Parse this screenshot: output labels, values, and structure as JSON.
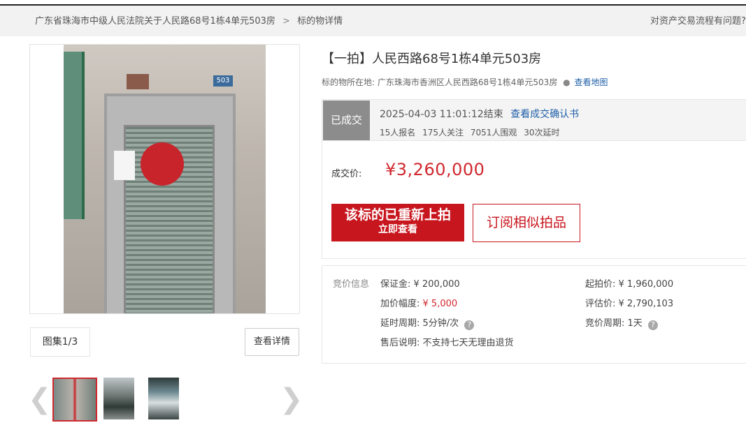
{
  "breadcrumb": {
    "parent": "广东省珠海市中级人民法院关于人民路68号1栋4单元503房",
    "separator": ">",
    "current": "标的物详情"
  },
  "help_text": "对资产交易流程有问题?",
  "gallery": {
    "album_label": "图集1/3",
    "detail_button": "查看详情",
    "plate_text": "503",
    "prev_icon": "chevron-left-icon",
    "next_icon": "chevron-right-icon",
    "thumb_count": 3
  },
  "item": {
    "title": "【一拍】人民西路68号1栋4单元503房",
    "location_label": "标的物所在地:",
    "location_value": "广东珠海市香洲区人民西路68号1栋4单元503房",
    "map_link": "查看地图"
  },
  "status": {
    "badge": "已成交",
    "end_time": "2025-04-03 11:01:12结束",
    "confirm_link": "查看成交确认书",
    "signups": "15人报名",
    "followers": "175人关注",
    "viewers": "7051人围观",
    "extensions": "30次延时"
  },
  "deal": {
    "price_label": "成交价:",
    "price_value": "¥3,260,000"
  },
  "actions": {
    "relist_line1": "该标的已重新上拍",
    "relist_line2": "立即查看",
    "subscribe": "订阅相似拍品"
  },
  "bid_info": {
    "label": "竞价信息",
    "deposit_label": "保证金:",
    "deposit_value": "¥ 200,000",
    "start_price_label": "起拍价:",
    "start_price_value": "¥ 1,960,000",
    "increment_label": "加价幅度:",
    "increment_value": "¥ 5,000",
    "appraisal_label": "评估价:",
    "appraisal_value": "¥ 2,790,103",
    "delay_label": "延时周期:",
    "delay_value": "5分钟/次",
    "cycle_label": "竞价周期:",
    "cycle_value": "1天",
    "aftersale_label": "售后说明:",
    "aftersale_value": "不支持七天无理由退货"
  },
  "colors": {
    "accent_red": "#c8161e",
    "price_red": "#d0282e",
    "link_blue": "#1f5fa8",
    "badge_gray": "#8c8c8c"
  }
}
